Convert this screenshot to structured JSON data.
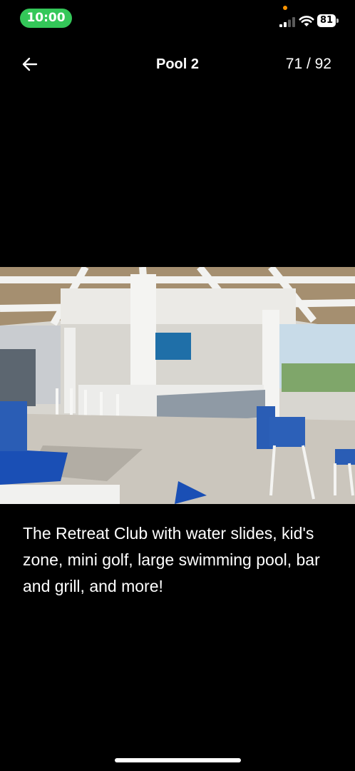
{
  "status_bar": {
    "time": "10:00",
    "battery": "81"
  },
  "header": {
    "title": "Pool 2",
    "counter": "71 / 92"
  },
  "photo": {
    "caption": "The Retreat Club with water slides, kid's zone, mini golf, large swimming pool, bar and grill, and more!"
  },
  "icons": {
    "back": "arrow-left-icon",
    "signal": "cellular-signal-icon",
    "wifi": "wifi-icon",
    "battery": "battery-icon"
  },
  "colors": {
    "background": "#000000",
    "time_pill": "#34c759",
    "privacy_dot": "#ff9500"
  }
}
